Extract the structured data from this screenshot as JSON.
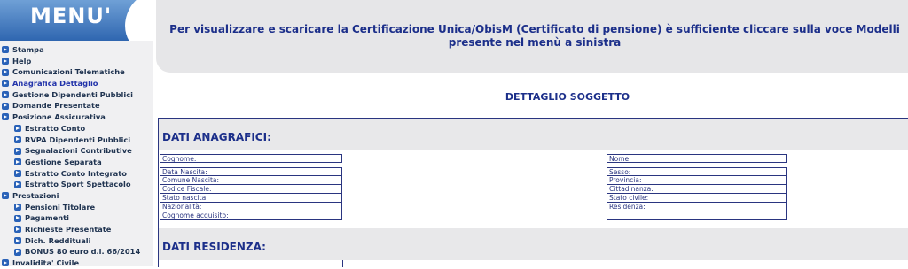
{
  "sidebar": {
    "title": "MENU'",
    "items": [
      {
        "label": "Stampa"
      },
      {
        "label": "Help"
      },
      {
        "label": "Comunicazioni Telematiche"
      },
      {
        "label": "Anagrafica Dettaglio"
      },
      {
        "label": "Gestione Dipendenti Pubblici"
      },
      {
        "label": "Domande Presentate"
      },
      {
        "label": "Posizione Assicurativa"
      },
      {
        "label": "Estratto Conto"
      },
      {
        "label": "RVPA Dipendenti Pubblici"
      },
      {
        "label": "Segnalazioni Contributive"
      },
      {
        "label": "Gestione Separata"
      },
      {
        "label": "Estratto Conto Integrato"
      },
      {
        "label": "Estratto Sport Spettacolo"
      },
      {
        "label": "Prestazioni"
      },
      {
        "label": "Pensioni Titolare"
      },
      {
        "label": "Pagamenti"
      },
      {
        "label": "Richieste Presentate"
      },
      {
        "label": "Dich. Reddituali"
      },
      {
        "label": "BONUS 80 euro d.l. 66/2014"
      },
      {
        "label": "Invalidita' Civile"
      }
    ]
  },
  "info": {
    "text": "Per visualizzare e scaricare la Certificazione Unica/ObisM (Certificato di pensione) è sufficiente cliccare sulla voce Modelli presente nel menù a sinistra"
  },
  "detail": {
    "heading": "DETTAGLIO SOGGETTO"
  },
  "sections": {
    "anagrafici": "DATI ANAGRAFICI:",
    "residenza": "DATI RESIDENZA:"
  },
  "fields": {
    "cognome": "Cognome:",
    "nome": "Nome:",
    "data_nascita": "Data Nascita:",
    "sesso": "Sesso:",
    "comune_nascita": "Comune Nascita:",
    "provincia": "Provincia:",
    "codice_fiscale": "Codice Fiscale:",
    "cittadinanza": "Cittadinanza:",
    "stato_nascita": "Stato nascita:",
    "stato_civile": "Stato civile:",
    "nazionalita": "Nazionalità:",
    "residenza": "Residenza:",
    "cognome_acquisito": "Cognome acquisito:"
  },
  "colors": {
    "menu_banner": "#2f66b0",
    "text_dark_blue": "#1c2f8a",
    "sidebar_bg": "#f0f0f2",
    "panel_bg": "#e6e6e8"
  }
}
